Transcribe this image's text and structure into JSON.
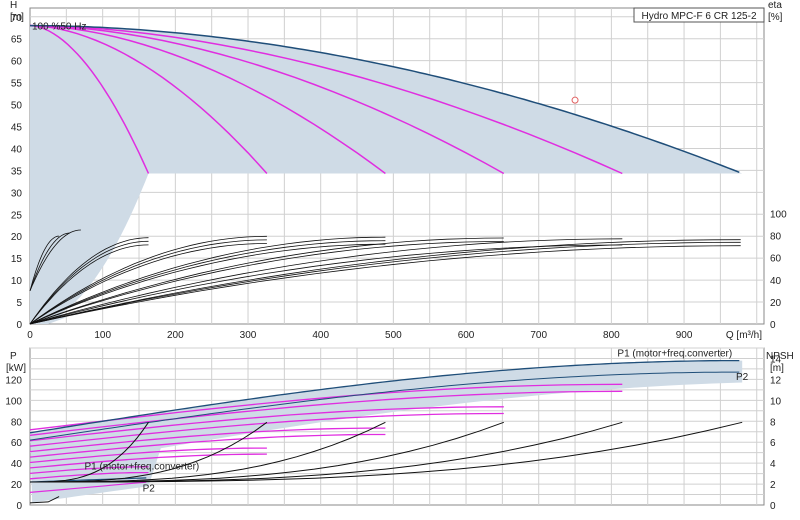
{
  "chart_data": [
    {
      "type": "line",
      "title": "Hydro MPC-F 6 CR 125-2",
      "ylabel": "H",
      "yunit": "[m]",
      "y2label": "eta",
      "y2unit": "[%]",
      "xlabel": "Q [m³/h]",
      "xlim": [
        0,
        1010
      ],
      "ylim": [
        0,
        72
      ],
      "y2lim": [
        0,
        100
      ],
      "xticks": [
        0,
        100,
        200,
        300,
        400,
        500,
        600,
        700,
        800,
        900
      ],
      "yticks": [
        0,
        5,
        10,
        15,
        20,
        25,
        30,
        35,
        40,
        45,
        50,
        55,
        60,
        65,
        70
      ],
      "y2ticks": [
        0,
        20,
        40,
        60,
        80,
        100
      ],
      "grid": true,
      "annotation": "100 %50 Hz",
      "operating_point": {
        "q": 750,
        "h": 51
      },
      "min_head": 34.3,
      "envelope_color": "#cfdbe6",
      "full_curve_color": "#1f4e79",
      "speed_curve_color": "#e02ee0",
      "h_series": [
        {
          "n_pumps": 1,
          "q_max": 163
        },
        {
          "n_pumps": 2,
          "q_max": 326
        },
        {
          "n_pumps": 3,
          "q_max": 489
        },
        {
          "n_pumps": 4,
          "q_max": 652
        },
        {
          "n_pumps": 5,
          "q_max": 815
        },
        {
          "n_pumps": 6,
          "q_max": 980
        }
      ],
      "eta_peak_percent": 80
    },
    {
      "type": "line",
      "ylabel": "P",
      "yunit": "[kW]",
      "y2label": "NPSH",
      "y2unit": "[m]",
      "xlim": [
        0,
        1010
      ],
      "ylim": [
        0,
        150
      ],
      "y2lim": [
        0,
        15
      ],
      "yticks": [
        0,
        20,
        40,
        60,
        80,
        100,
        120
      ],
      "y2ticks": [
        0,
        2,
        4,
        6,
        8,
        10,
        12,
        14
      ],
      "grid": true,
      "series_labels": {
        "p1_top": "P1 (motor+freq.converter)",
        "p2_top": "P2",
        "p1_bottom": "P1 (motor+freq.converter)",
        "p2_bottom": "P2"
      },
      "p1_full": {
        "q": [
          0,
          980
        ],
        "p": [
          69,
          138
        ]
      },
      "p2_full": {
        "q": [
          0,
          980
        ],
        "p": [
          62,
          127
        ]
      },
      "npsh_max": {
        "q": [
          30,
          163,
          326,
          489,
          652,
          815,
          980
        ],
        "npsh": [
          0.3,
          7.9,
          7.9,
          7.9,
          7.9,
          7.9,
          7.9
        ]
      }
    }
  ]
}
